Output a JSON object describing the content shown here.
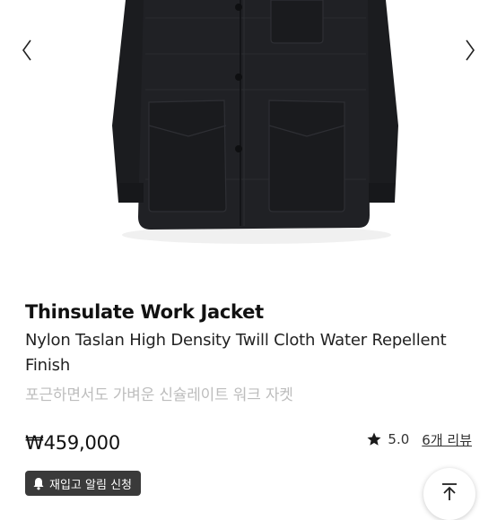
{
  "gallery": {
    "image_alt": "black work jacket",
    "prev_icon": "chevron-left-icon",
    "next_icon": "chevron-right-icon"
  },
  "product": {
    "name": "Thinsulate Work Jacket",
    "subtitle": "Nylon Taslan High Density Twill Cloth Water Repellent Finish",
    "description_ko": "포근하면서도 가벼운 신슐레이트 워크 자켓",
    "price": "₩459,000",
    "rating": {
      "icon": "star-icon",
      "score": "5.0",
      "reviews_label": "6개 리뷰"
    }
  },
  "actions": {
    "restock_icon": "bell-icon",
    "restock_label": "재입고 알림 신청",
    "scroll_top_icon": "arrow-up-icon"
  },
  "colors": {
    "jacket": "#1c1d20",
    "restock_bg": "#3a3a3a",
    "muted_text": "#bdbdbd"
  }
}
